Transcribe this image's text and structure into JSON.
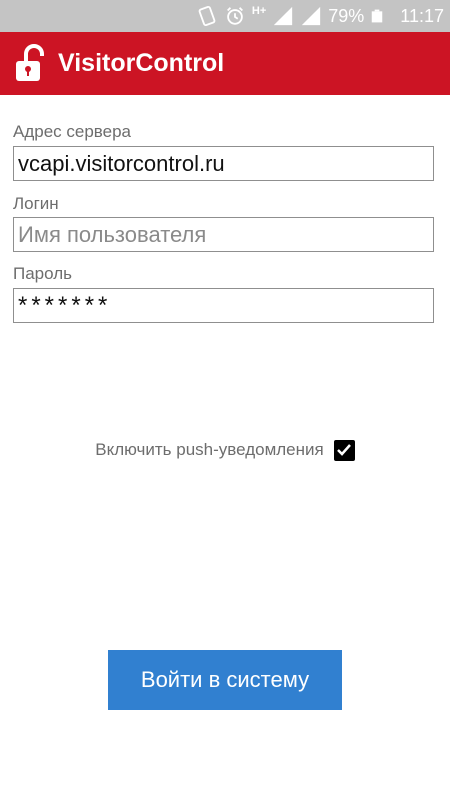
{
  "status_bar": {
    "battery": "79%",
    "time": "11:17",
    "network": "H+",
    "icons": [
      "no-sim-icon",
      "alarm-icon",
      "signal-icon",
      "signal-icon",
      "battery-icon"
    ]
  },
  "header": {
    "logo_text": "VisitorControl",
    "background_color": "#cc1424"
  },
  "form": {
    "server_label": "Адрес сервера",
    "server_value": "vcapi.visitorcontrol.ru",
    "login_label": "Логин",
    "login_placeholder": "Имя пользователя",
    "login_value": "",
    "password_label": "Пароль",
    "password_value": "*******"
  },
  "push": {
    "label": "Включить push-уведомления",
    "checked": true
  },
  "login_button": {
    "label": "Войти в систему",
    "color": "#3180d0"
  }
}
